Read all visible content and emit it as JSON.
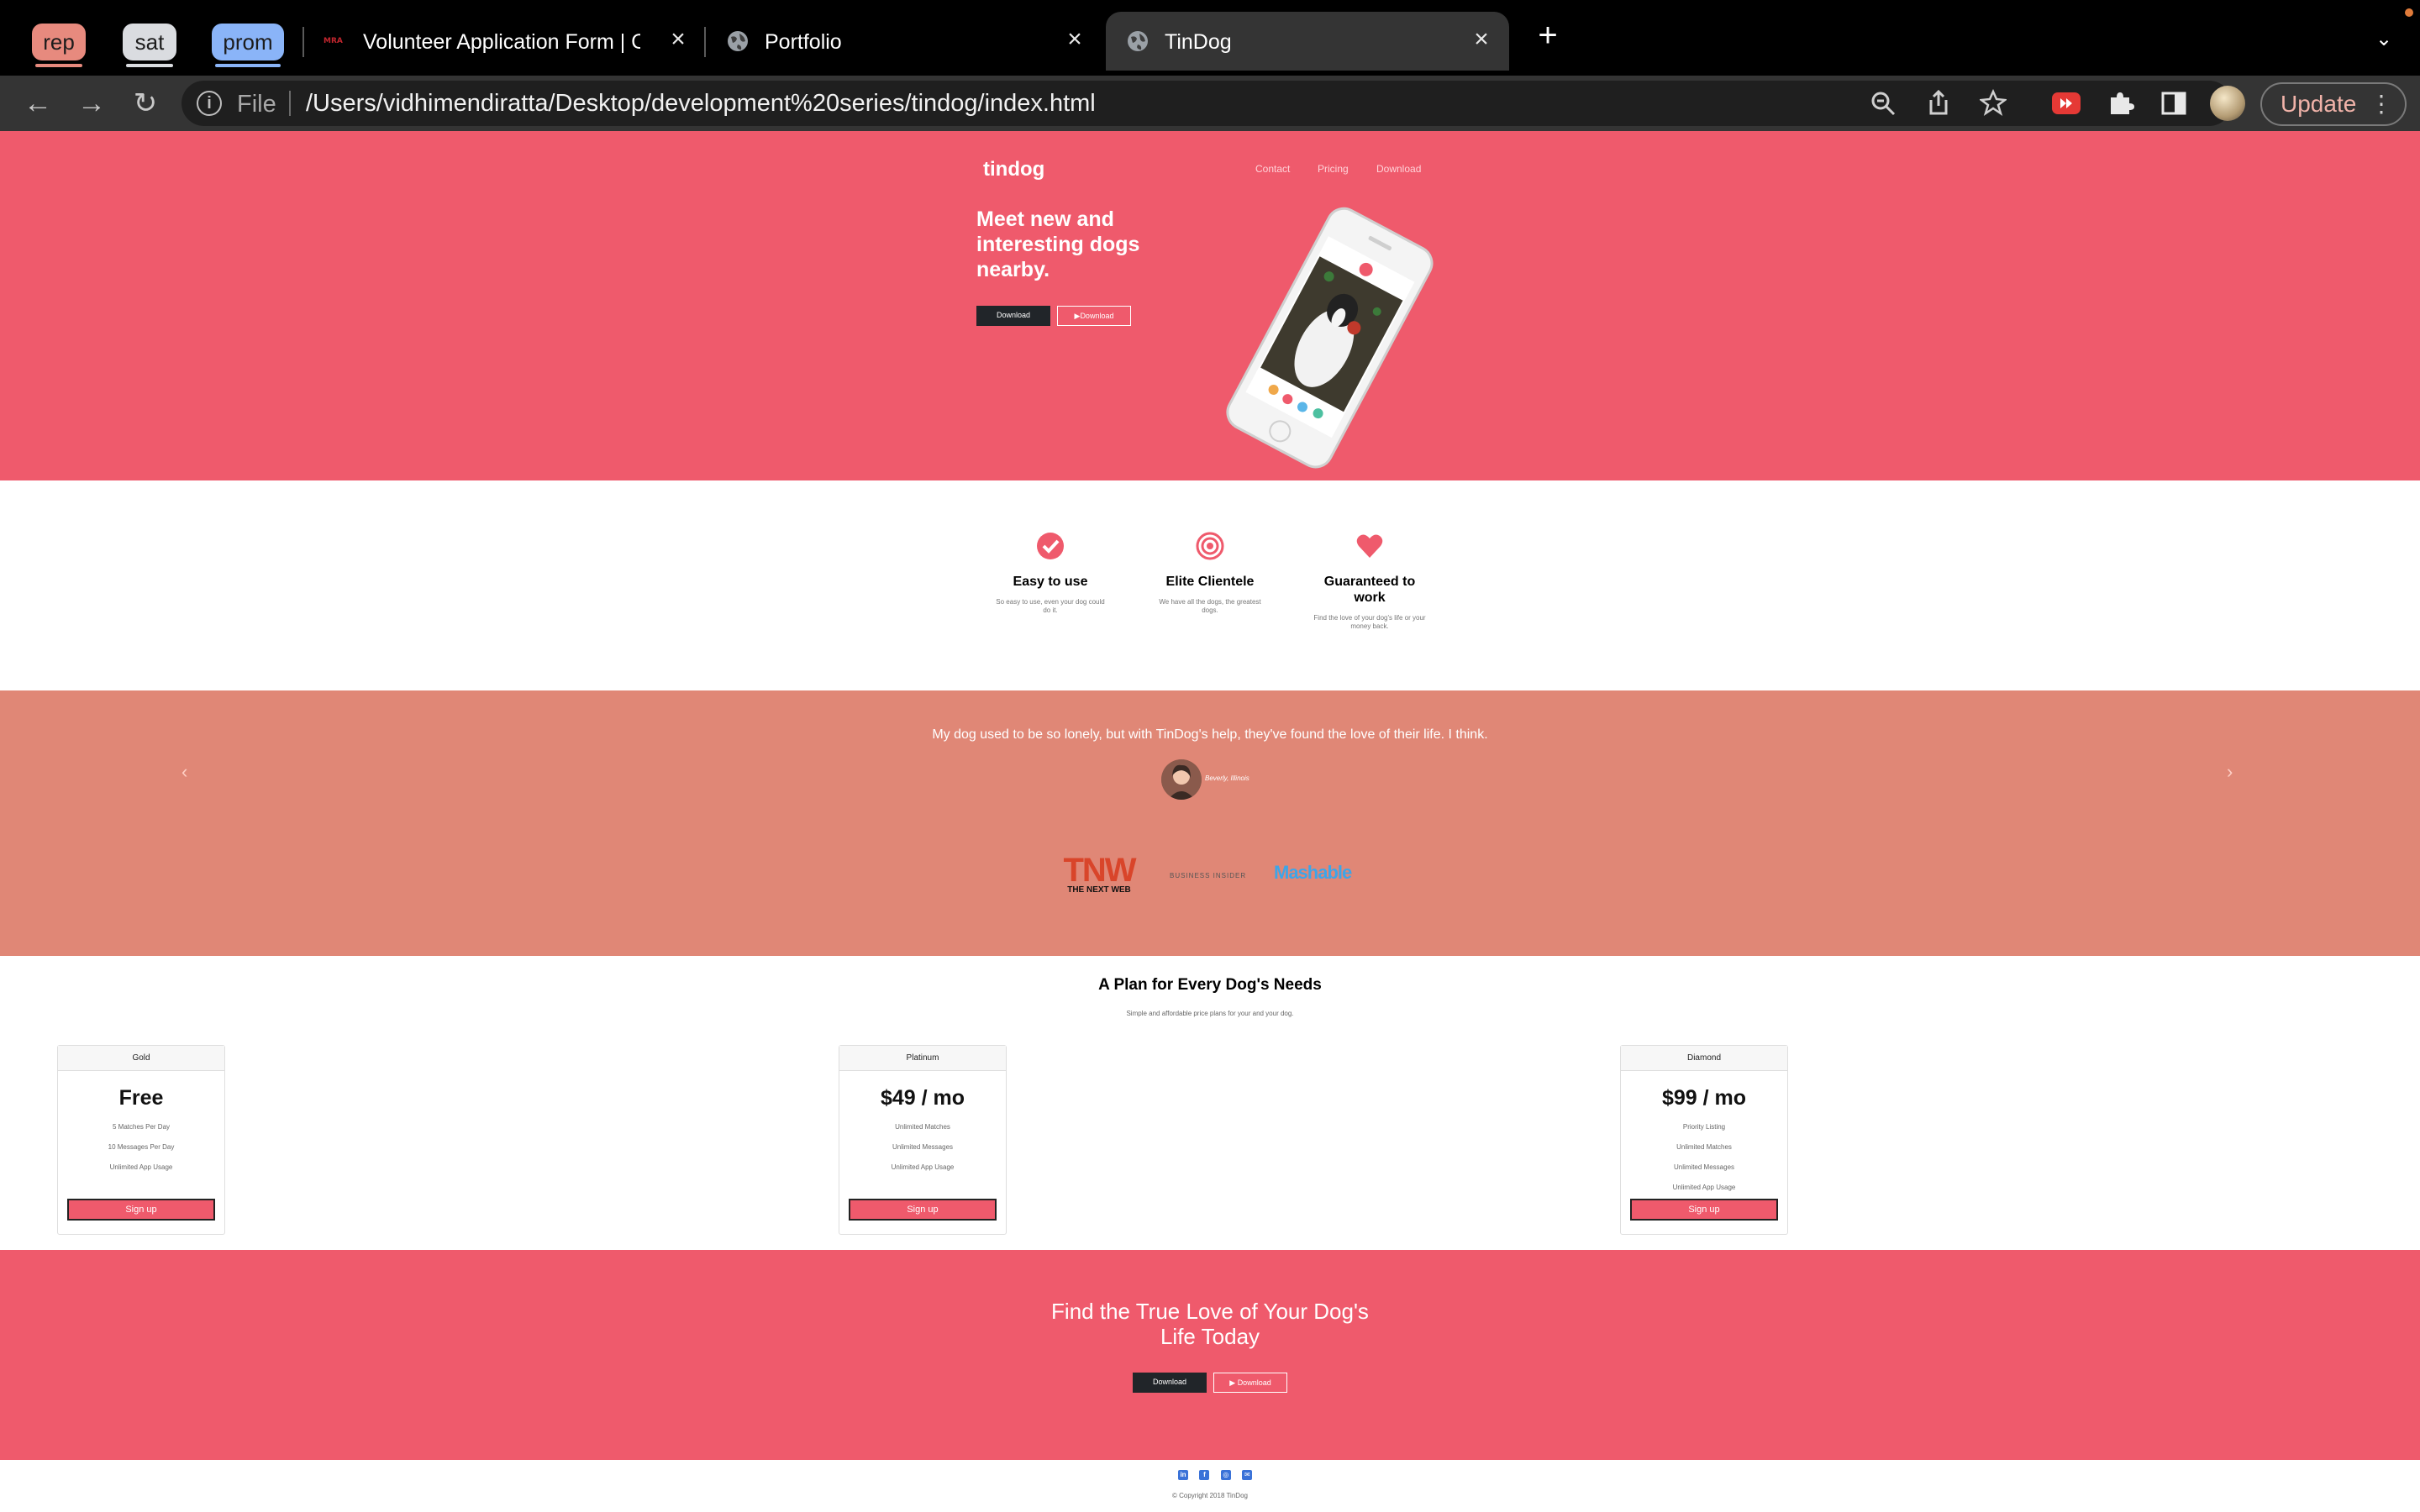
{
  "browser": {
    "tab_groups": [
      {
        "label": "rep",
        "color": "#e78a7e"
      },
      {
        "label": "sat",
        "color": "#dadce0"
      },
      {
        "label": "prom",
        "color": "#8ab4f8"
      }
    ],
    "tabs": [
      {
        "title": "Volunteer Application Form | Cl",
        "icon": "favicon-icon"
      },
      {
        "title": "Portfolio",
        "icon": "globe-icon"
      },
      {
        "title": "TinDog",
        "icon": "globe-icon",
        "active": true
      }
    ],
    "address_scheme": "File",
    "address_url": "/Users/vidhimendiratta/Desktop/development%20series/tindog/index.html",
    "update_label": "Update"
  },
  "hero": {
    "brand": "tindog",
    "nav": [
      "Contact",
      "Pricing",
      "Download"
    ],
    "title": "Meet new and interesting dogs nearby.",
    "download_apple": "Download",
    "download_play": "Download"
  },
  "features": [
    {
      "icon": "check-circle-icon",
      "title": "Easy to use",
      "text": "So easy to use, even your dog could do it."
    },
    {
      "icon": "bullseye-icon",
      "title": "Elite Clientele",
      "text": "We have all the dogs, the greatest dogs."
    },
    {
      "icon": "heart-icon",
      "title": "Guaranteed to work",
      "text": "Find the love of your dog's life or your money back."
    }
  ],
  "testimonial": {
    "quote": "My dog used to be so lonely, but with TinDog's help, they've found the love of their life. I think.",
    "author": "Beverly, Illinois",
    "press": [
      "TNW",
      "THE NEXT WEB",
      "BUSINESS INSIDER",
      "Mashable"
    ]
  },
  "pricing": {
    "title": "A Plan for Every Dog's Needs",
    "subtitle": "Simple and affordable price plans for your and your dog.",
    "plans": [
      {
        "name": "Gold",
        "price": "Free",
        "features": [
          "5 Matches Per Day",
          "10 Messages Per Day",
          "Unlimited App Usage"
        ],
        "button": "Sign up"
      },
      {
        "name": "Platinum",
        "price": "$49 / mo",
        "features": [
          "Unlimited Matches",
          "Unlimited Messages",
          "Unlimited App Usage"
        ],
        "button": "Sign up"
      },
      {
        "name": "Diamond",
        "price": "$99 / mo",
        "features": [
          "Priority Listing",
          "Unlimited Matches",
          "Unlimited Messages",
          "Unlimited App Usage"
        ],
        "button": "Sign up"
      }
    ]
  },
  "cta": {
    "title_line1": "Find the True Love of Your Dog's",
    "title_line2": "Life Today",
    "download_apple": "Download",
    "download_play": "Download"
  },
  "footer": {
    "copyright": "© Copyright 2018 TinDog"
  }
}
